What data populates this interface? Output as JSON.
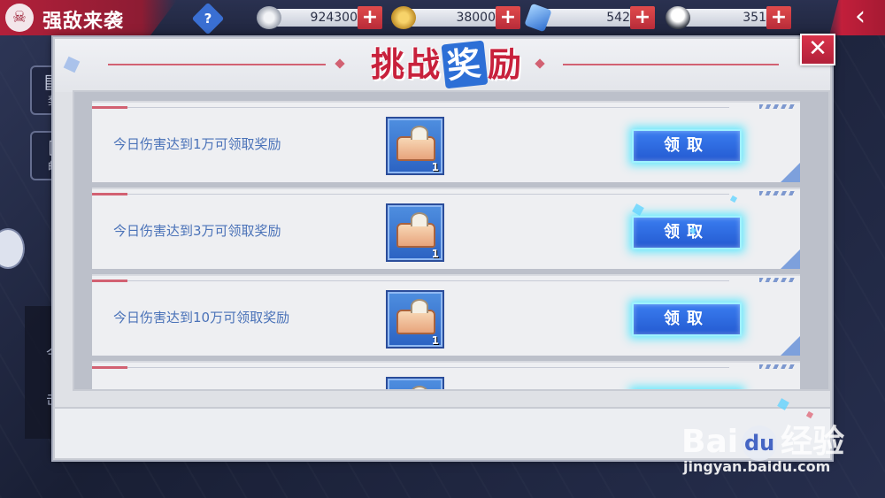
{
  "header": {
    "title": "强敌来袭",
    "help_icon": "question-icon",
    "back_icon": "chevron-left-icon"
  },
  "resources": [
    {
      "name": "silver-coin-icon",
      "value": "924300"
    },
    {
      "name": "gold-coin-icon",
      "value": "38000"
    },
    {
      "name": "crystal-icon",
      "value": "542"
    },
    {
      "name": "rice-ball-icon",
      "value": "351"
    }
  ],
  "side": {
    "btn1_label": "奖",
    "btn2_label": "邮",
    "panel_text1": "今",
    "panel_text2": "击"
  },
  "dialog": {
    "title_part1": "挑战",
    "title_highlight": "奖",
    "title_part2": "励",
    "close_label": "✕",
    "rows": [
      {
        "desc": "今日伤害达到1万可领取奖励",
        "qty": "1",
        "claim": "领取"
      },
      {
        "desc": "今日伤害达到3万可领取奖励",
        "qty": "1",
        "claim": "领取"
      },
      {
        "desc": "今日伤害达到10万可领取奖励",
        "qty": "1",
        "claim": "领取"
      },
      {
        "desc": "",
        "qty": "",
        "claim": ""
      }
    ]
  },
  "watermark": {
    "brand": "Bai",
    "brand2": "经验",
    "url": "jingyan.baidu.com"
  },
  "colors": {
    "accent_red": "#c8213c",
    "accent_blue": "#2d6fd6",
    "glow": "#46e6ff"
  }
}
